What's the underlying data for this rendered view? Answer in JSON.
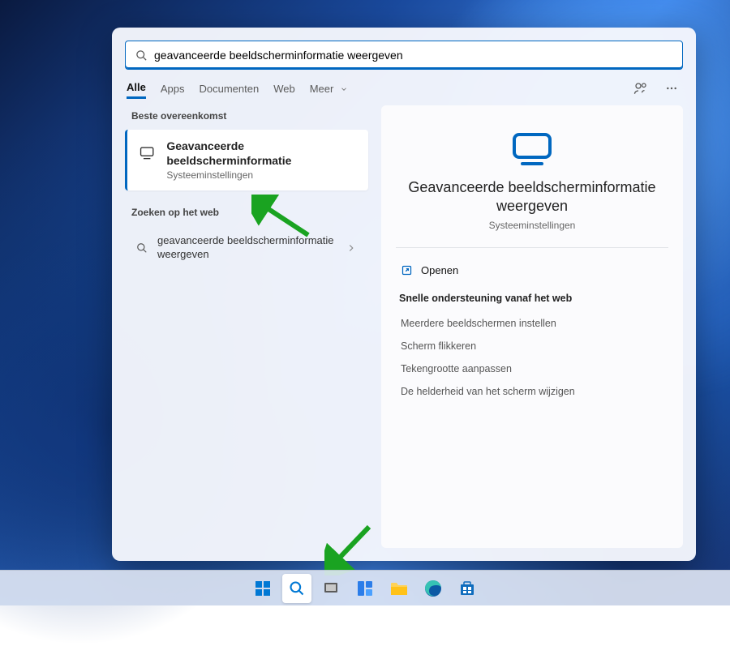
{
  "search": {
    "value": "geavanceerde beeldscherminformatie weergeven"
  },
  "tabs": {
    "all": "Alle",
    "apps": "Apps",
    "docs": "Documenten",
    "web": "Web",
    "more": "Meer"
  },
  "left": {
    "best_label": "Beste overeenkomst",
    "best_title": "Geavanceerde beeldscherminformatie",
    "best_sub": "Systeeminstellingen",
    "web_label": "Zoeken op het web",
    "web_text": "geavanceerde beeldscherminformatie weergeven"
  },
  "preview": {
    "title": "Geavanceerde beeldscherminformatie weergeven",
    "sub": "Systeeminstellingen",
    "open": "Openen",
    "quick_label": "Snelle ondersteuning vanaf het web",
    "links": [
      "Meerdere beeldschermen instellen",
      "Scherm flikkeren",
      "Tekengrootte aanpassen",
      "De helderheid van het scherm wijzigen"
    ]
  },
  "colors": {
    "accent": "#0067c0",
    "arrow": "#1aa321"
  }
}
